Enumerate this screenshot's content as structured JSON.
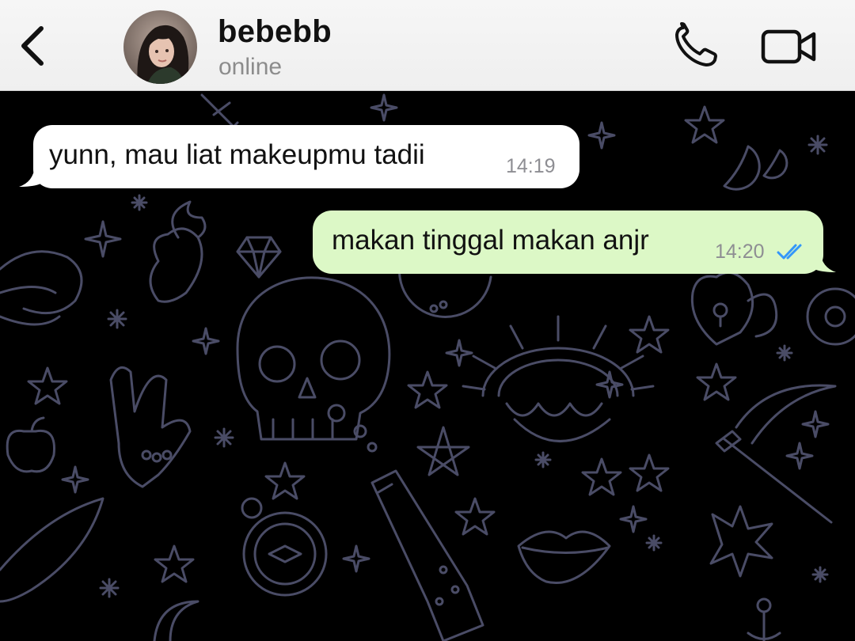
{
  "header": {
    "back_icon": "chevron-left-icon",
    "contact_name": "bebebb",
    "status": "online",
    "call_icon": "phone-icon",
    "video_icon": "video-camera-icon"
  },
  "messages": [
    {
      "direction": "incoming",
      "text": "yunn, mau liat makeupmu tadii",
      "time": "14:19"
    },
    {
      "direction": "outgoing",
      "text": "makan tinggal makan anjr",
      "time": "14:20",
      "read_icon": "double-check-icon",
      "read_color": "#3497f9"
    }
  ],
  "colors": {
    "header_bg": "#f6f6f6",
    "chat_bg": "#000000",
    "incoming_bubble": "#ffffff",
    "outgoing_bubble": "#dcf8c6",
    "doodle_stroke": "#4a4c66",
    "timestamp": "#8e8e93"
  }
}
